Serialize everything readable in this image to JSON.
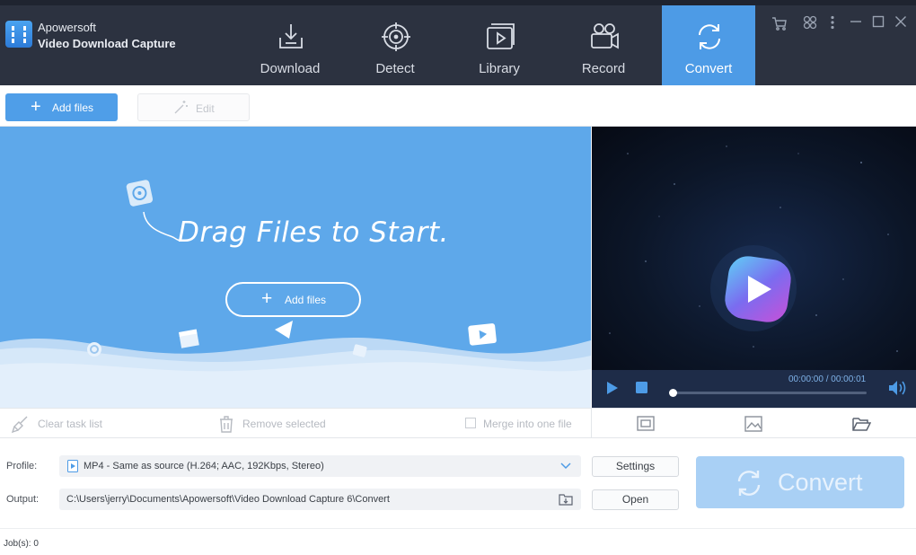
{
  "app": {
    "name_line1": "Apowersoft",
    "name_line2": "Video Download Capture"
  },
  "tabs": [
    {
      "label": "Download",
      "icon": "download-icon",
      "active": false
    },
    {
      "label": "Detect",
      "icon": "detect-icon",
      "active": false
    },
    {
      "label": "Library",
      "icon": "library-icon",
      "active": false
    },
    {
      "label": "Record",
      "icon": "record-icon",
      "active": false
    },
    {
      "label": "Convert",
      "icon": "convert-icon",
      "active": true
    }
  ],
  "window_controls": [
    "cart-icon",
    "apps-icon",
    "more-icon",
    "minimize-icon",
    "maximize-icon",
    "close-icon"
  ],
  "toolbar": {
    "add_files_label": "Add files",
    "edit_label": "Edit"
  },
  "dropzone": {
    "headline": "Drag Files to Start.",
    "add_files_label": "Add files"
  },
  "player": {
    "time": "00:00:00 / 00:00:01",
    "progress": 0
  },
  "actions": {
    "clear_label": "Clear task list",
    "remove_label": "Remove selected",
    "merge_label": "Merge into one file"
  },
  "settings": {
    "profile_label": "Profile:",
    "profile_value": "MP4 - Same as source (H.264; AAC, 192Kbps, Stereo)",
    "output_label": "Output:",
    "output_value": "C:\\Users\\jerry\\Documents\\Apowersoft\\Video Download Capture 6\\Convert",
    "settings_button": "Settings",
    "open_button": "Open",
    "convert_button": "Convert"
  },
  "status": {
    "jobs": "Job(s): 0"
  },
  "colors": {
    "titlebar": "#2c3240",
    "accent": "#4d9be6",
    "dropzone": "#5ea8ea",
    "convert_disabled": "#a9d0f5"
  }
}
